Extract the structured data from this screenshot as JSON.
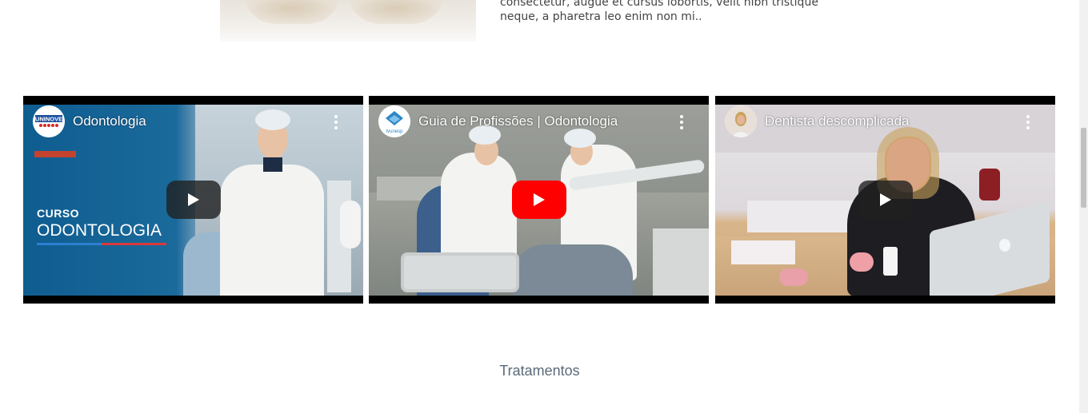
{
  "intro": {
    "text": "consectetur, augue et cursus lobortis, velit nibh tristique neque, a pharetra leo enim non mi.."
  },
  "videos": [
    {
      "title": "Odontologia",
      "channel_icon": "uninove-logo",
      "overlay_line1": "CURSO",
      "overlay_line2": "ODONTOLOGIA",
      "play_style": "dark"
    },
    {
      "title": "Guia de Profissões | Odontologia",
      "channel_icon": "tv-unesp-logo",
      "channel_caption": "tvunesp",
      "play_style": "red"
    },
    {
      "title": "Dentista descomplicada",
      "channel_icon": "avatar",
      "play_style": "dark"
    }
  ],
  "section": {
    "title": "Tratamentos"
  },
  "colors": {
    "play_red": "#ff0000",
    "section_title": "#5b6a79"
  }
}
